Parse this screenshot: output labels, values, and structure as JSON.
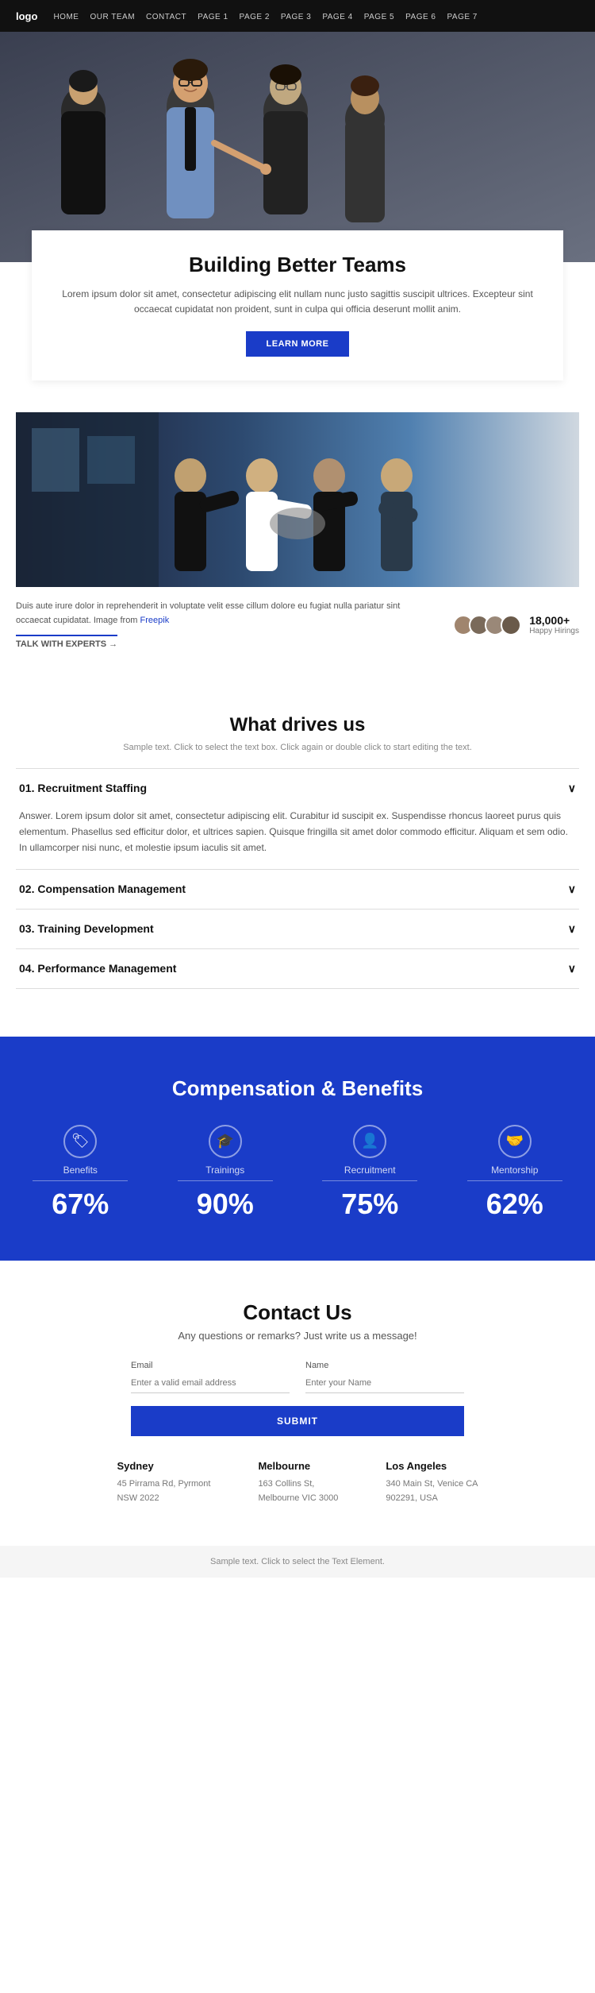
{
  "nav": {
    "logo": "logo",
    "links": [
      {
        "label": "HOME",
        "href": "#"
      },
      {
        "label": "OUR TEAM",
        "href": "#"
      },
      {
        "label": "CONTACT",
        "href": "#"
      },
      {
        "label": "PAGE 1",
        "href": "#"
      },
      {
        "label": "PAGE 2",
        "href": "#"
      },
      {
        "label": "PAGE 3",
        "href": "#"
      },
      {
        "label": "PAGE 4",
        "href": "#"
      },
      {
        "label": "PAGE 5",
        "href": "#"
      },
      {
        "label": "PAGE 6",
        "href": "#"
      },
      {
        "label": "PAGE 7",
        "href": "#"
      }
    ]
  },
  "hero": {
    "alt": "Business team photo"
  },
  "intro": {
    "title": "Building Better Teams",
    "description": "Lorem ipsum dolor sit amet, consectetur adipiscing elit nullam nunc justo sagittis suscipit ultrices. Excepteur sint occaecat cupidatat non proident, sunt in culpa qui officia deserunt mollit anim.",
    "button_label": "LEARN MORE"
  },
  "team_section": {
    "body_text": "Duis aute irure dolor in reprehenderit in voluptate velit esse cillum dolore eu fugiat nulla pariatur sint occaecat cupidatat. Image from",
    "freepik_link": "Freepik",
    "talk_link": "TALK WITH EXPERTS →",
    "stats_number": "18,000+",
    "stats_label": "Happy Hirings"
  },
  "what_drives": {
    "title": "What drives us",
    "subtitle": "Sample text. Click to select the text box. Click again or double click to start editing the text.",
    "items": [
      {
        "number": "01.",
        "title": "Recruitment Staffing",
        "expanded": true,
        "body": "Answer. Lorem ipsum dolor sit amet, consectetur adipiscing elit. Curabitur id suscipit ex. Suspendisse rhoncus laoreet purus quis elementum. Phasellus sed efficitur dolor, et ultrices sapien. Quisque fringilla sit amet dolor commodo efficitur. Aliquam et sem odio. In ullamcorper nisi nunc, et molestie ipsum iaculis sit amet."
      },
      {
        "number": "02.",
        "title": "Compensation Management",
        "expanded": false,
        "body": ""
      },
      {
        "number": "03.",
        "title": "Training Development",
        "expanded": false,
        "body": ""
      },
      {
        "number": "04.",
        "title": "Performance Management",
        "expanded": false,
        "body": ""
      }
    ]
  },
  "compensation": {
    "title": "Compensation & Benefits",
    "items": [
      {
        "icon": "🏷",
        "label": "Benefits",
        "percent": "67%"
      },
      {
        "icon": "🎓",
        "label": "Trainings",
        "percent": "90%"
      },
      {
        "icon": "👤",
        "label": "Recruitment",
        "percent": "75%"
      },
      {
        "icon": "🤝",
        "label": "Mentorship",
        "percent": "62%"
      }
    ]
  },
  "contact": {
    "title": "Contact Us",
    "tagline": "Any questions or remarks? Just write us a message!",
    "email_label": "Email",
    "email_placeholder": "Enter a valid email address",
    "name_label": "Name",
    "name_placeholder": "Enter your Name",
    "submit_label": "SUBMIT",
    "offices": [
      {
        "city": "Sydney",
        "address": "45 Pirrama Rd, Pyrmont",
        "address2": "NSW 2022"
      },
      {
        "city": "Melbourne",
        "address": "163 Collins St,",
        "address2": "Melbourne VIC 3000"
      },
      {
        "city": "Los Angeles",
        "address": "340 Main St, Venice CA",
        "address2": "902291, USA"
      }
    ]
  },
  "footer": {
    "text": "Sample text. Click to select the Text Element."
  }
}
